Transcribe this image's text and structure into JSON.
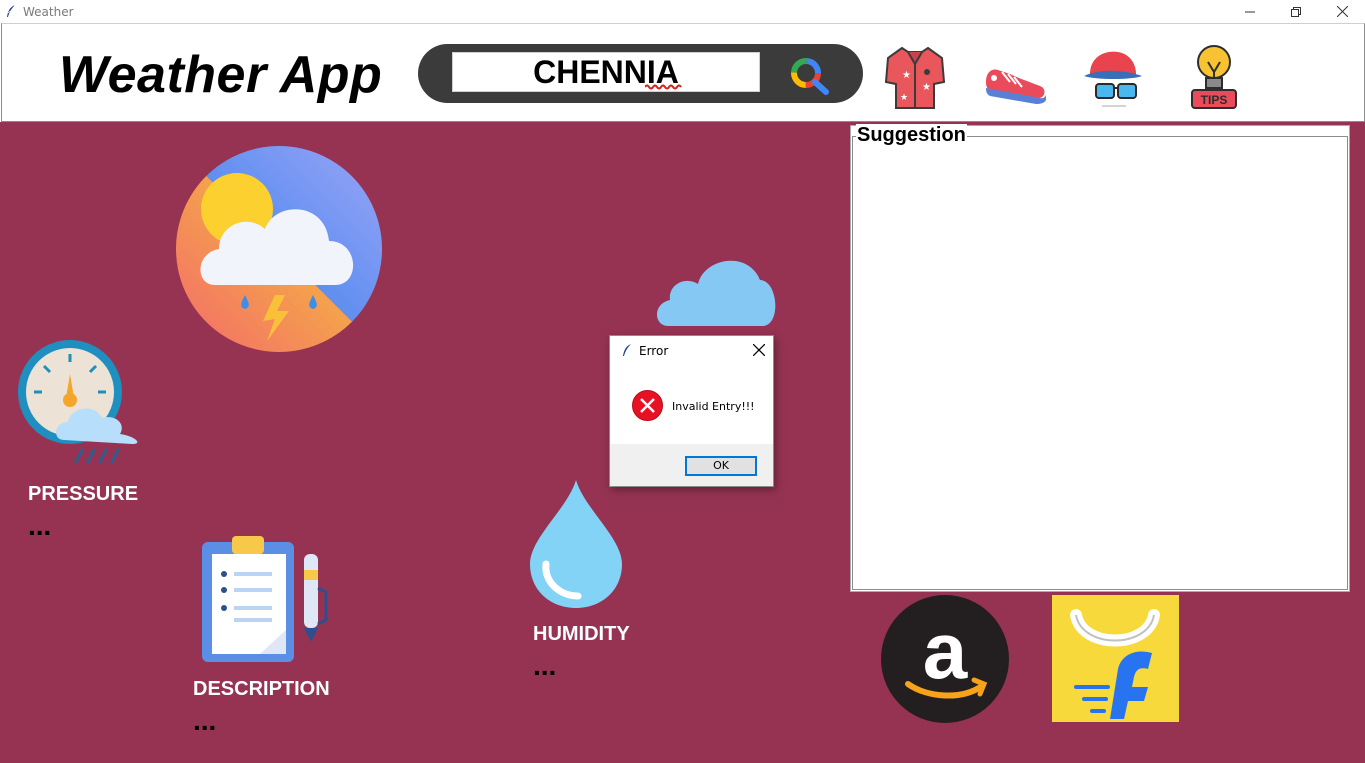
{
  "window": {
    "title": "Weather"
  },
  "header": {
    "app_title": "Weather App",
    "search": {
      "value": "CHENNIA"
    },
    "icons": [
      "shirt-icon",
      "sneaker-icon",
      "cap-sunglasses-icon",
      "tips-bulb-icon"
    ],
    "tips_label": "TIPS"
  },
  "main": {
    "background": "#963352",
    "pressure": {
      "label": "PRESSURE",
      "value": "..."
    },
    "description": {
      "label": "DESCRIPTION",
      "value": "..."
    },
    "humidity": {
      "label": "HUMIDITY",
      "value": "..."
    }
  },
  "suggestion": {
    "title": "Suggestion"
  },
  "dialog": {
    "title": "Error",
    "message": "Invalid Entry!!!",
    "ok_label": "OK"
  },
  "shops": [
    "amazon-icon",
    "flipkart-icon"
  ]
}
